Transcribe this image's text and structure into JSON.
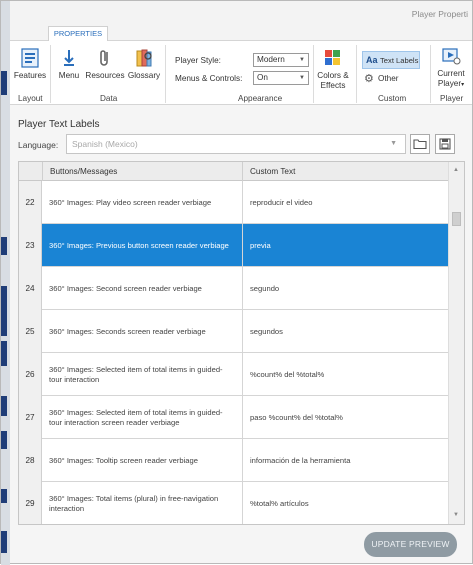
{
  "window": {
    "title": "Player Properti"
  },
  "ribbon": {
    "tab": "PROPERTIES",
    "groups": {
      "layout": {
        "label": "Layout",
        "features": "Features"
      },
      "data": {
        "label": "Data",
        "menu": "Menu",
        "resources": "Resources",
        "glossary": "Glossary"
      },
      "appearance": {
        "label": "Appearance",
        "player_style_label": "Player Style:",
        "player_style_value": "Modern",
        "menus_controls_label": "Menus & Controls:",
        "menus_controls_value": "On",
        "colors_effects": "Colors &",
        "colors_effects_2": "Effects"
      },
      "custom": {
        "label": "Custom",
        "text_labels": "Text Labels",
        "other": "Other"
      },
      "player": {
        "label": "Player",
        "current_player": "Current",
        "current_player_2": "Player"
      }
    },
    "accent": "#2a6ebb"
  },
  "panel": {
    "title": "Player Text Labels",
    "language_label": "Language:",
    "language_value": "Spanish (Mexico)",
    "columns": [
      "Buttons/Messages",
      "Custom Text"
    ],
    "rows": [
      {
        "num": "22",
        "message": "360° Images: Play video screen reader verbiage",
        "custom": "reproducir el video",
        "selected": false
      },
      {
        "num": "23",
        "message": "360° Images: Previous button screen reader verbiage",
        "custom": "previa",
        "selected": true
      },
      {
        "num": "24",
        "message": "360° Images: Second screen reader verbiage",
        "custom": "segundo",
        "selected": false
      },
      {
        "num": "25",
        "message": "360° Images: Seconds screen reader verbiage",
        "custom": "segundos",
        "selected": false
      },
      {
        "num": "26",
        "message": "360° Images: Selected item of total items in guided-tour interaction",
        "custom": "%count% del %total%",
        "selected": false
      },
      {
        "num": "27",
        "message": "360° Images: Selected item of total items in guided-tour interaction screen reader verbiage",
        "custom": "paso %count% del %total%",
        "selected": false
      },
      {
        "num": "28",
        "message": "360° Images: Tooltip screen reader verbiage",
        "custom": "información de la herramienta",
        "selected": false
      },
      {
        "num": "29",
        "message": "360° Images: Total items (plural) in free-navigation interaction",
        "custom": "%total% artículos",
        "selected": false
      }
    ],
    "update_button": "UPDATE PREVIEW",
    "selection_color": "#1a84d4"
  }
}
